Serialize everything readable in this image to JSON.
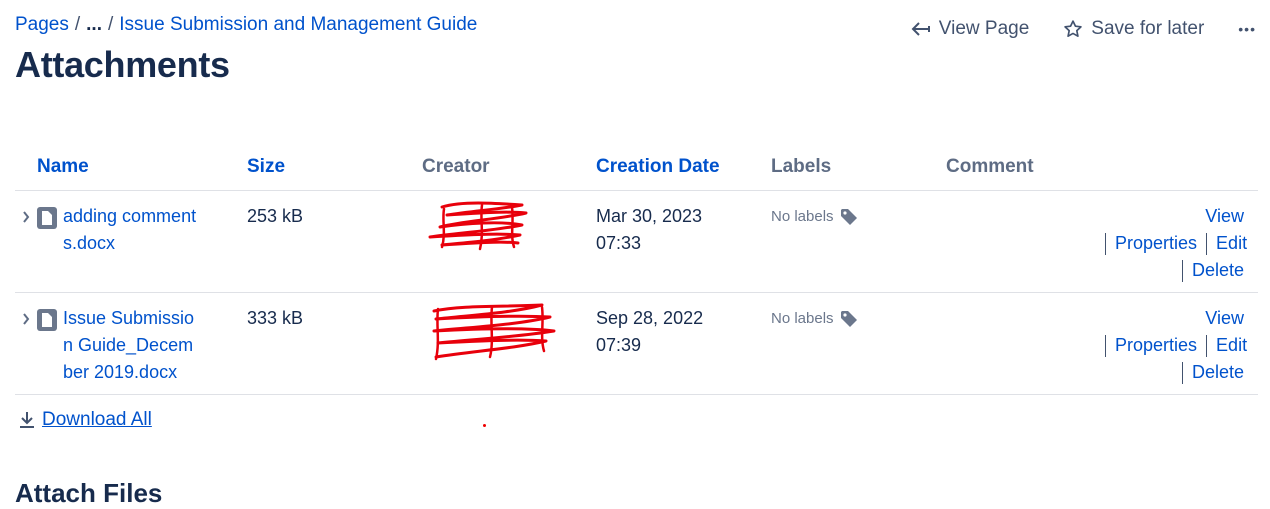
{
  "breadcrumb": {
    "pages": "Pages",
    "sep1": "/",
    "ellipsis": "...",
    "sep2": "/",
    "parent": "Issue Submission and Management Guide"
  },
  "title": "Attachments",
  "actions": {
    "view_page": "View Page",
    "save_for_later": "Save for later",
    "more": "•••"
  },
  "table": {
    "headers": {
      "name": "Name",
      "size": "Size",
      "creator": "Creator",
      "creation_date": "Creation Date",
      "labels": "Labels",
      "comment": "Comment"
    },
    "rows": [
      {
        "name": "adding comments.docx",
        "size": "253 kB",
        "date_line1": "Mar 30, 2023",
        "date_line2": "07:33",
        "labels": "No labels",
        "ops": {
          "view": "View",
          "properties": "Properties",
          "edit": "Edit",
          "delete": "Delete"
        }
      },
      {
        "name": "Issue Submission Guide_December 2019.docx",
        "size": "333 kB",
        "date_line1": "Sep 28, 2022",
        "date_line2": "07:39",
        "labels": "No labels",
        "ops": {
          "view": "View",
          "properties": "Properties",
          "edit": "Edit",
          "delete": "Delete"
        }
      }
    ]
  },
  "download_all": "Download All",
  "attach_files_heading": "Attach Files",
  "colors": {
    "link": "#0052cc",
    "text": "#172b4d",
    "muted": "#5e6c84",
    "redaction": "#e8000b"
  }
}
